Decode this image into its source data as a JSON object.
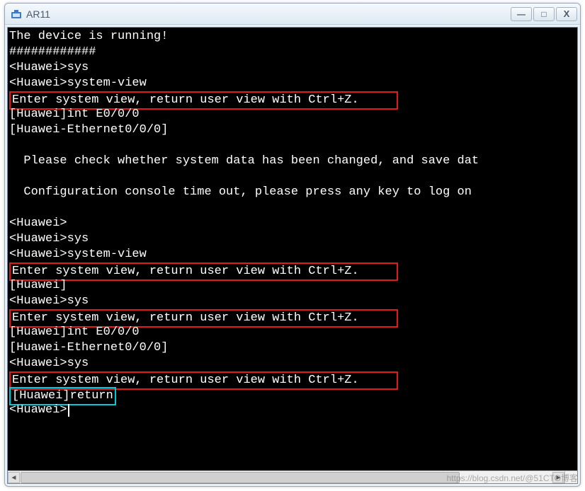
{
  "window": {
    "title": "AR11"
  },
  "controls": {
    "min": "—",
    "max": "□",
    "close": "X"
  },
  "terminal": {
    "lines": [
      {
        "text": "The device is running!",
        "hl": ""
      },
      {
        "text": "############",
        "hl": ""
      },
      {
        "text": "<Huawei>sys",
        "hl": ""
      },
      {
        "text": "<Huawei>system-view",
        "hl": ""
      },
      {
        "text": "Enter system view, return user view with Ctrl+Z.     ",
        "hl": "red"
      },
      {
        "text": "[Huawei]int E0/0/0",
        "hl": ""
      },
      {
        "text": "[Huawei-Ethernet0/0/0]",
        "hl": ""
      },
      {
        "text": "",
        "hl": ""
      },
      {
        "text": "  Please check whether system data has been changed, and save dat",
        "hl": ""
      },
      {
        "text": "",
        "hl": ""
      },
      {
        "text": "  Configuration console time out, please press any key to log on",
        "hl": ""
      },
      {
        "text": "",
        "hl": ""
      },
      {
        "text": "<Huawei>",
        "hl": ""
      },
      {
        "text": "<Huawei>sys",
        "hl": ""
      },
      {
        "text": "<Huawei>system-view",
        "hl": ""
      },
      {
        "text": "Enter system view, return user view with Ctrl+Z.     ",
        "hl": "red"
      },
      {
        "text": "[Huawei]",
        "hl": ""
      },
      {
        "text": "<Huawei>sys",
        "hl": ""
      },
      {
        "text": "Enter system view, return user view with Ctrl+Z.     ",
        "hl": "red"
      },
      {
        "text": "[Huawei]int E0/0/0",
        "hl": ""
      },
      {
        "text": "[Huawei-Ethernet0/0/0]",
        "hl": ""
      },
      {
        "text": "<Huawei>sys",
        "hl": ""
      },
      {
        "text": "Enter system view, return user view with Ctrl+Z.     ",
        "hl": "red"
      },
      {
        "text": "[Huawei]return",
        "hl": "cyan"
      },
      {
        "text": "<Huawei>",
        "hl": "",
        "cursor": true
      }
    ]
  },
  "watermark": "https://blog.csdn.net/@51CTO博客"
}
